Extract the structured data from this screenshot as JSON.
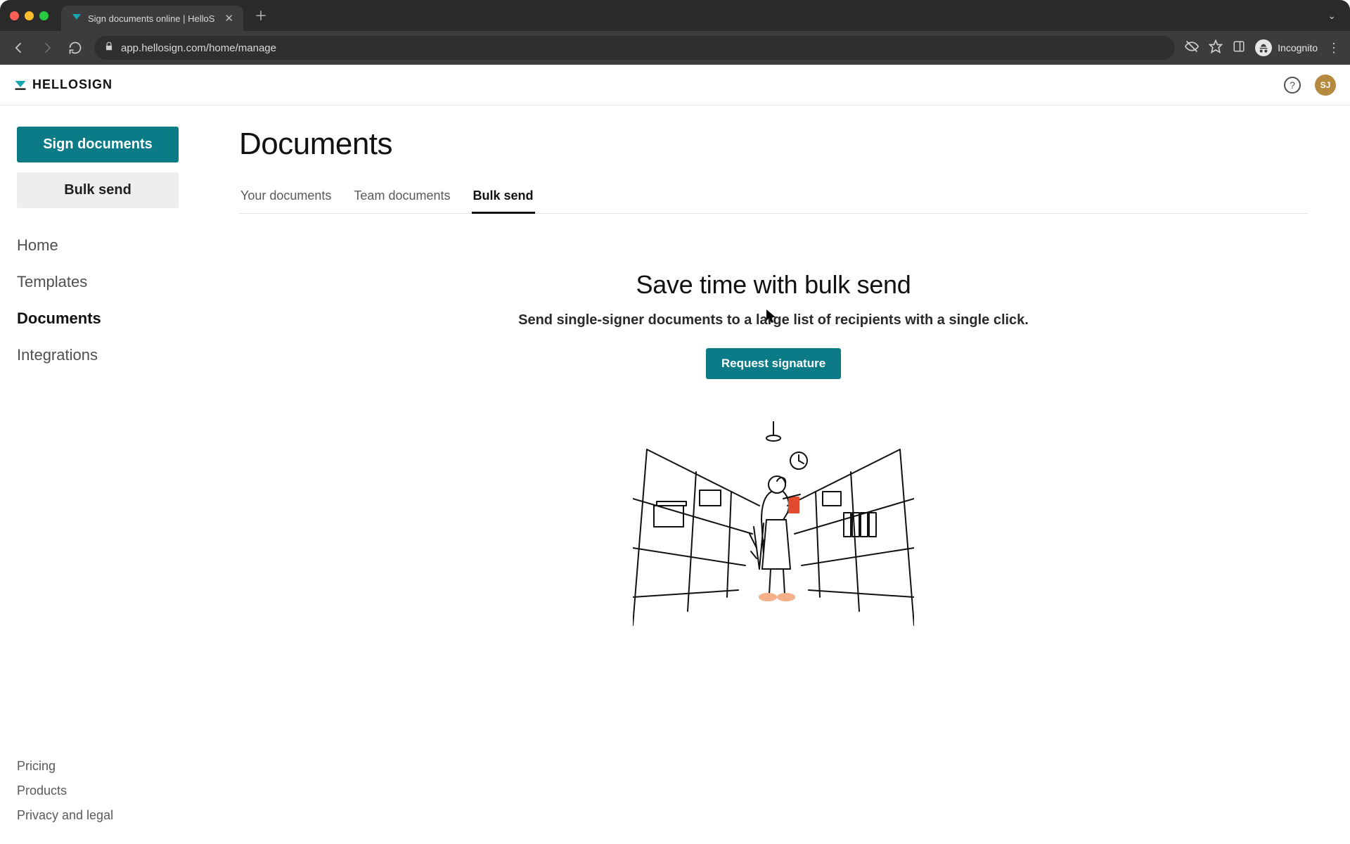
{
  "browser": {
    "tab_title": "Sign documents online | HelloS",
    "url": "app.hellosign.com/home/manage",
    "incognito_label": "Incognito"
  },
  "header": {
    "logo_text": "HELLOSIGN",
    "avatar_initials": "SJ"
  },
  "sidebar": {
    "cta_primary": "Sign documents",
    "cta_secondary": "Bulk send",
    "nav": {
      "home": "Home",
      "templates": "Templates",
      "documents": "Documents",
      "integrations": "Integrations"
    },
    "footer": {
      "pricing": "Pricing",
      "products": "Products",
      "privacy": "Privacy and legal"
    }
  },
  "main": {
    "title": "Documents",
    "tabs": {
      "your": "Your documents",
      "team": "Team documents",
      "bulk": "Bulk send"
    },
    "hero": {
      "headline": "Save time with bulk send",
      "subtext": "Send single-signer documents to a large list of recipients with a single click.",
      "cta": "Request signature"
    }
  }
}
